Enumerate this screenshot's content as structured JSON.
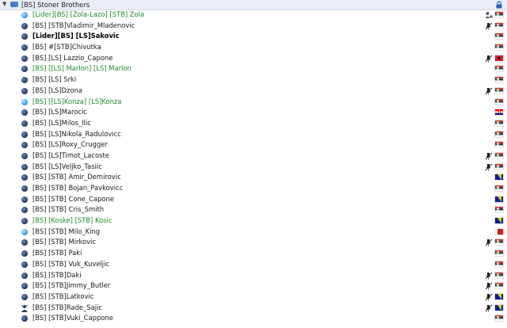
{
  "channel": {
    "name": "[BS] Stoner Brothers",
    "expand_icon": "chevron-down-icon",
    "channel_icon": "channel-chat-icon",
    "lock_icon": "channel-lock-icon"
  },
  "users": [
    {
      "name": "[Lider][BS] [Zola-Lazo] [STB] Zola",
      "style": "green",
      "status": "active",
      "extra": "user-group-icon",
      "flag": "rs"
    },
    {
      "name": "[BS] [STB]Vladimir_Mladenovic",
      "style": "normal",
      "status": "idle",
      "extra": "muted-icon",
      "flag": "rs"
    },
    {
      "name": "[Lider][BS] [LS]Sakovic",
      "style": "bold",
      "status": "idle",
      "extra": "",
      "flag": "rs"
    },
    {
      "name": "[BS] #[STB]Chivutka",
      "style": "normal",
      "status": "idle",
      "extra": "",
      "flag": "rs"
    },
    {
      "name": "[BS] [LS] Lazzio_Capone",
      "style": "normal",
      "status": "idle",
      "extra": "muted-icon",
      "flag": "al"
    },
    {
      "name": "[BS] [[LS] Marlon] [LS] Marlon",
      "style": "green",
      "status": "idle",
      "extra": "",
      "flag": "rs"
    },
    {
      "name": "[BS] [LS] Srki",
      "style": "normal",
      "status": "idle",
      "extra": "",
      "flag": "rs"
    },
    {
      "name": "[BS] [LS]Dzona",
      "style": "normal",
      "status": "idle",
      "extra": "muted-icon",
      "flag": "rs"
    },
    {
      "name": "[BS] [[LS]Konza] [LS]Konza",
      "style": "green",
      "status": "active",
      "extra": "",
      "flag": "rs"
    },
    {
      "name": "[BS] [LS]Marocic",
      "style": "normal",
      "status": "idle",
      "extra": "",
      "flag": "hr"
    },
    {
      "name": "[BS] [LS]Milos_Ilic",
      "style": "normal",
      "status": "idle",
      "extra": "",
      "flag": "rs"
    },
    {
      "name": "[BS] [LS]Nikola_Radulovicc",
      "style": "normal",
      "status": "idle",
      "extra": "",
      "flag": "rs"
    },
    {
      "name": "[BS] [LS]Roxy_Crugger",
      "style": "normal",
      "status": "idle",
      "extra": "",
      "flag": "rs"
    },
    {
      "name": "[BS] [LS]Timot_Lacoste",
      "style": "normal",
      "status": "idle",
      "extra": "muted-icon",
      "flag": "rs"
    },
    {
      "name": "[BS] [LS]Veljko_Tasiic",
      "style": "normal",
      "status": "idle",
      "extra": "muted-icon",
      "flag": "rs"
    },
    {
      "name": "[BS] [STB] Amir_Demirovic",
      "style": "normal",
      "status": "idle",
      "extra": "",
      "flag": "ba"
    },
    {
      "name": "[BS] [STB] Bojan_Pavkovicc",
      "style": "normal",
      "status": "idle",
      "extra": "",
      "flag": "rs"
    },
    {
      "name": "[BS] [STB] Cone_Capone",
      "style": "normal",
      "status": "idle",
      "extra": "",
      "flag": "ba"
    },
    {
      "name": "[BS] [STB] Cris_Smith",
      "style": "normal",
      "status": "idle",
      "extra": "",
      "flag": "rs"
    },
    {
      "name": "[BS] [Koske] [STB] Kosic",
      "style": "green",
      "status": "idle",
      "extra": "",
      "flag": "ba"
    },
    {
      "name": "[BS] [STB] Milo_King",
      "style": "normal",
      "status": "active",
      "extra": "",
      "flag": "redwhite"
    },
    {
      "name": "[BS] [STB] Mirkovic",
      "style": "normal",
      "status": "idle",
      "extra": "muted-icon",
      "flag": "rs"
    },
    {
      "name": "[BS] [STB] Paki",
      "style": "normal",
      "status": "idle",
      "extra": "",
      "flag": "rs"
    },
    {
      "name": "[BS] [STB] Vuk_Kuveljic",
      "style": "normal",
      "status": "idle",
      "extra": "",
      "flag": "rs"
    },
    {
      "name": "[BS] [STB]Daki",
      "style": "normal",
      "status": "idle",
      "extra": "muted-icon",
      "flag": "rs"
    },
    {
      "name": "[BS] [STB]Jimmy_Butler",
      "style": "normal",
      "status": "idle",
      "extra": "muted-icon",
      "flag": "rs"
    },
    {
      "name": "[BS] [STB]Latkovic",
      "style": "normal",
      "status": "idle",
      "extra": "muted-icon",
      "flag": "ba"
    },
    {
      "name": "[BS] [STB]Rade_Sajic",
      "style": "normal",
      "status": "query",
      "extra": "muted-icon",
      "flag": "ba"
    },
    {
      "name": "[BS] [STB]Vuki_Cappone",
      "style": "normal",
      "status": "idle",
      "extra": "",
      "flag": "rs"
    }
  ]
}
